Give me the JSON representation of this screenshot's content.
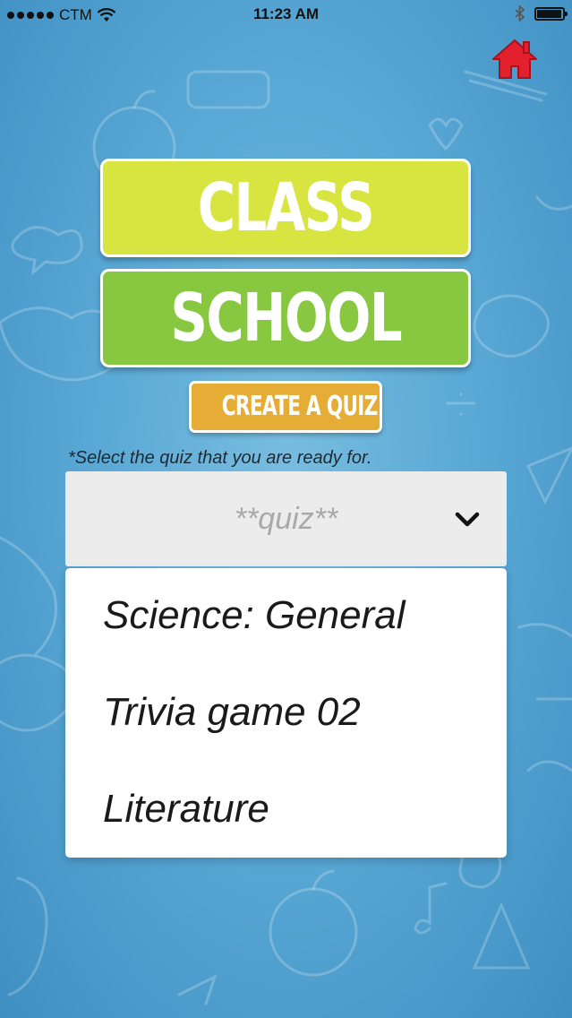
{
  "status_bar": {
    "carrier": "CTM",
    "time": "11:23 AM",
    "battery_level": 0.95
  },
  "header": {
    "home_icon": "home-icon",
    "home_color": "#e3202e"
  },
  "titles": {
    "class_label": "CLASS",
    "school_label": "SCHOOL",
    "class_color": "#d8e440",
    "school_color": "#88c840"
  },
  "create_quiz": {
    "label": "CREATE A QUIZ",
    "color": "#e5ad36"
  },
  "instruction": "*Select the quiz that you are ready for.",
  "quiz_select": {
    "placeholder": "**quiz**",
    "icon": "chevron-down-icon"
  },
  "dropdown": {
    "options": [
      {
        "label": "Science: General"
      },
      {
        "label": "Trivia game 02"
      },
      {
        "label": "Literature"
      }
    ]
  }
}
